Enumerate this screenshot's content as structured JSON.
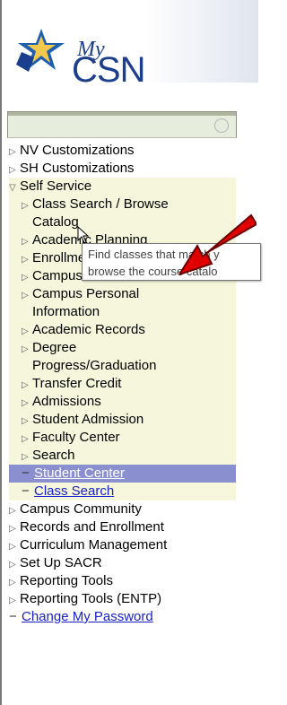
{
  "logo": {
    "my": "My",
    "csn": "CSN"
  },
  "nav": {
    "top_items": [
      "NV Customizations",
      "SH Customizations"
    ],
    "self_service": {
      "label": "Self Service",
      "children": [
        "Class Search / Browse Catalog",
        "Academic Planning",
        "Enrollment",
        "Campus Finances",
        "Campus Personal Information",
        "Academic Records",
        "Degree Progress/Graduation",
        "Transfer Credit",
        "Admissions",
        "Student Admission",
        "Faculty Center",
        "Search"
      ],
      "links": [
        "Student Center",
        "Class Search"
      ]
    },
    "bottom_items": [
      "Campus Community",
      "Records and Enrollment",
      "Curriculum Management",
      "Set Up SACR",
      "Reporting Tools",
      "Reporting Tools (ENTP)"
    ],
    "bottom_link": "Change My Password"
  },
  "tooltip": {
    "line1": "Find classes that match y",
    "line2": "browse the course catalo"
  },
  "colors": {
    "annotation_arrow": "#e00000",
    "link": "#1a21c8",
    "selected_row": "#8a8fd0"
  }
}
